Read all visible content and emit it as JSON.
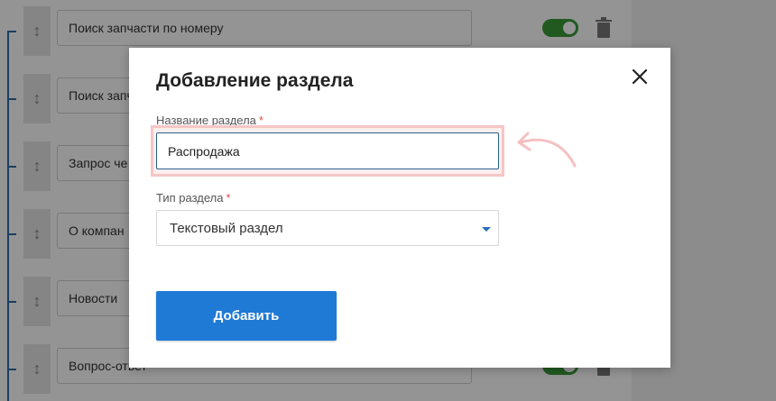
{
  "background_list": {
    "items": [
      {
        "label": "Поиск запчасти по номеру",
        "toggle_on": true
      },
      {
        "label": "Поиск запч",
        "toggle_on": true
      },
      {
        "label": "Запрос че",
        "toggle_on": true
      },
      {
        "label": "О компан",
        "toggle_on": true
      },
      {
        "label": "Новости",
        "toggle_on": true
      },
      {
        "label": "Вопрос-ответ",
        "toggle_on": true
      }
    ]
  },
  "modal": {
    "title": "Добавление раздела",
    "name_field": {
      "label": "Название раздела",
      "required_mark": "*",
      "value": "Распродажа"
    },
    "type_field": {
      "label": "Тип раздела",
      "required_mark": "*",
      "selected": "Текстовый раздел"
    },
    "submit_label": "Добавить"
  },
  "colors": {
    "accent": "#1f7ad6",
    "toggle_on": "#3a9a3a",
    "highlight": "#f5c6c6",
    "required": "#d9534f"
  },
  "icons": [
    "drag-handle-icon",
    "trash-icon",
    "close-icon",
    "chevron-down-icon",
    "curved-arrow-icon"
  ]
}
